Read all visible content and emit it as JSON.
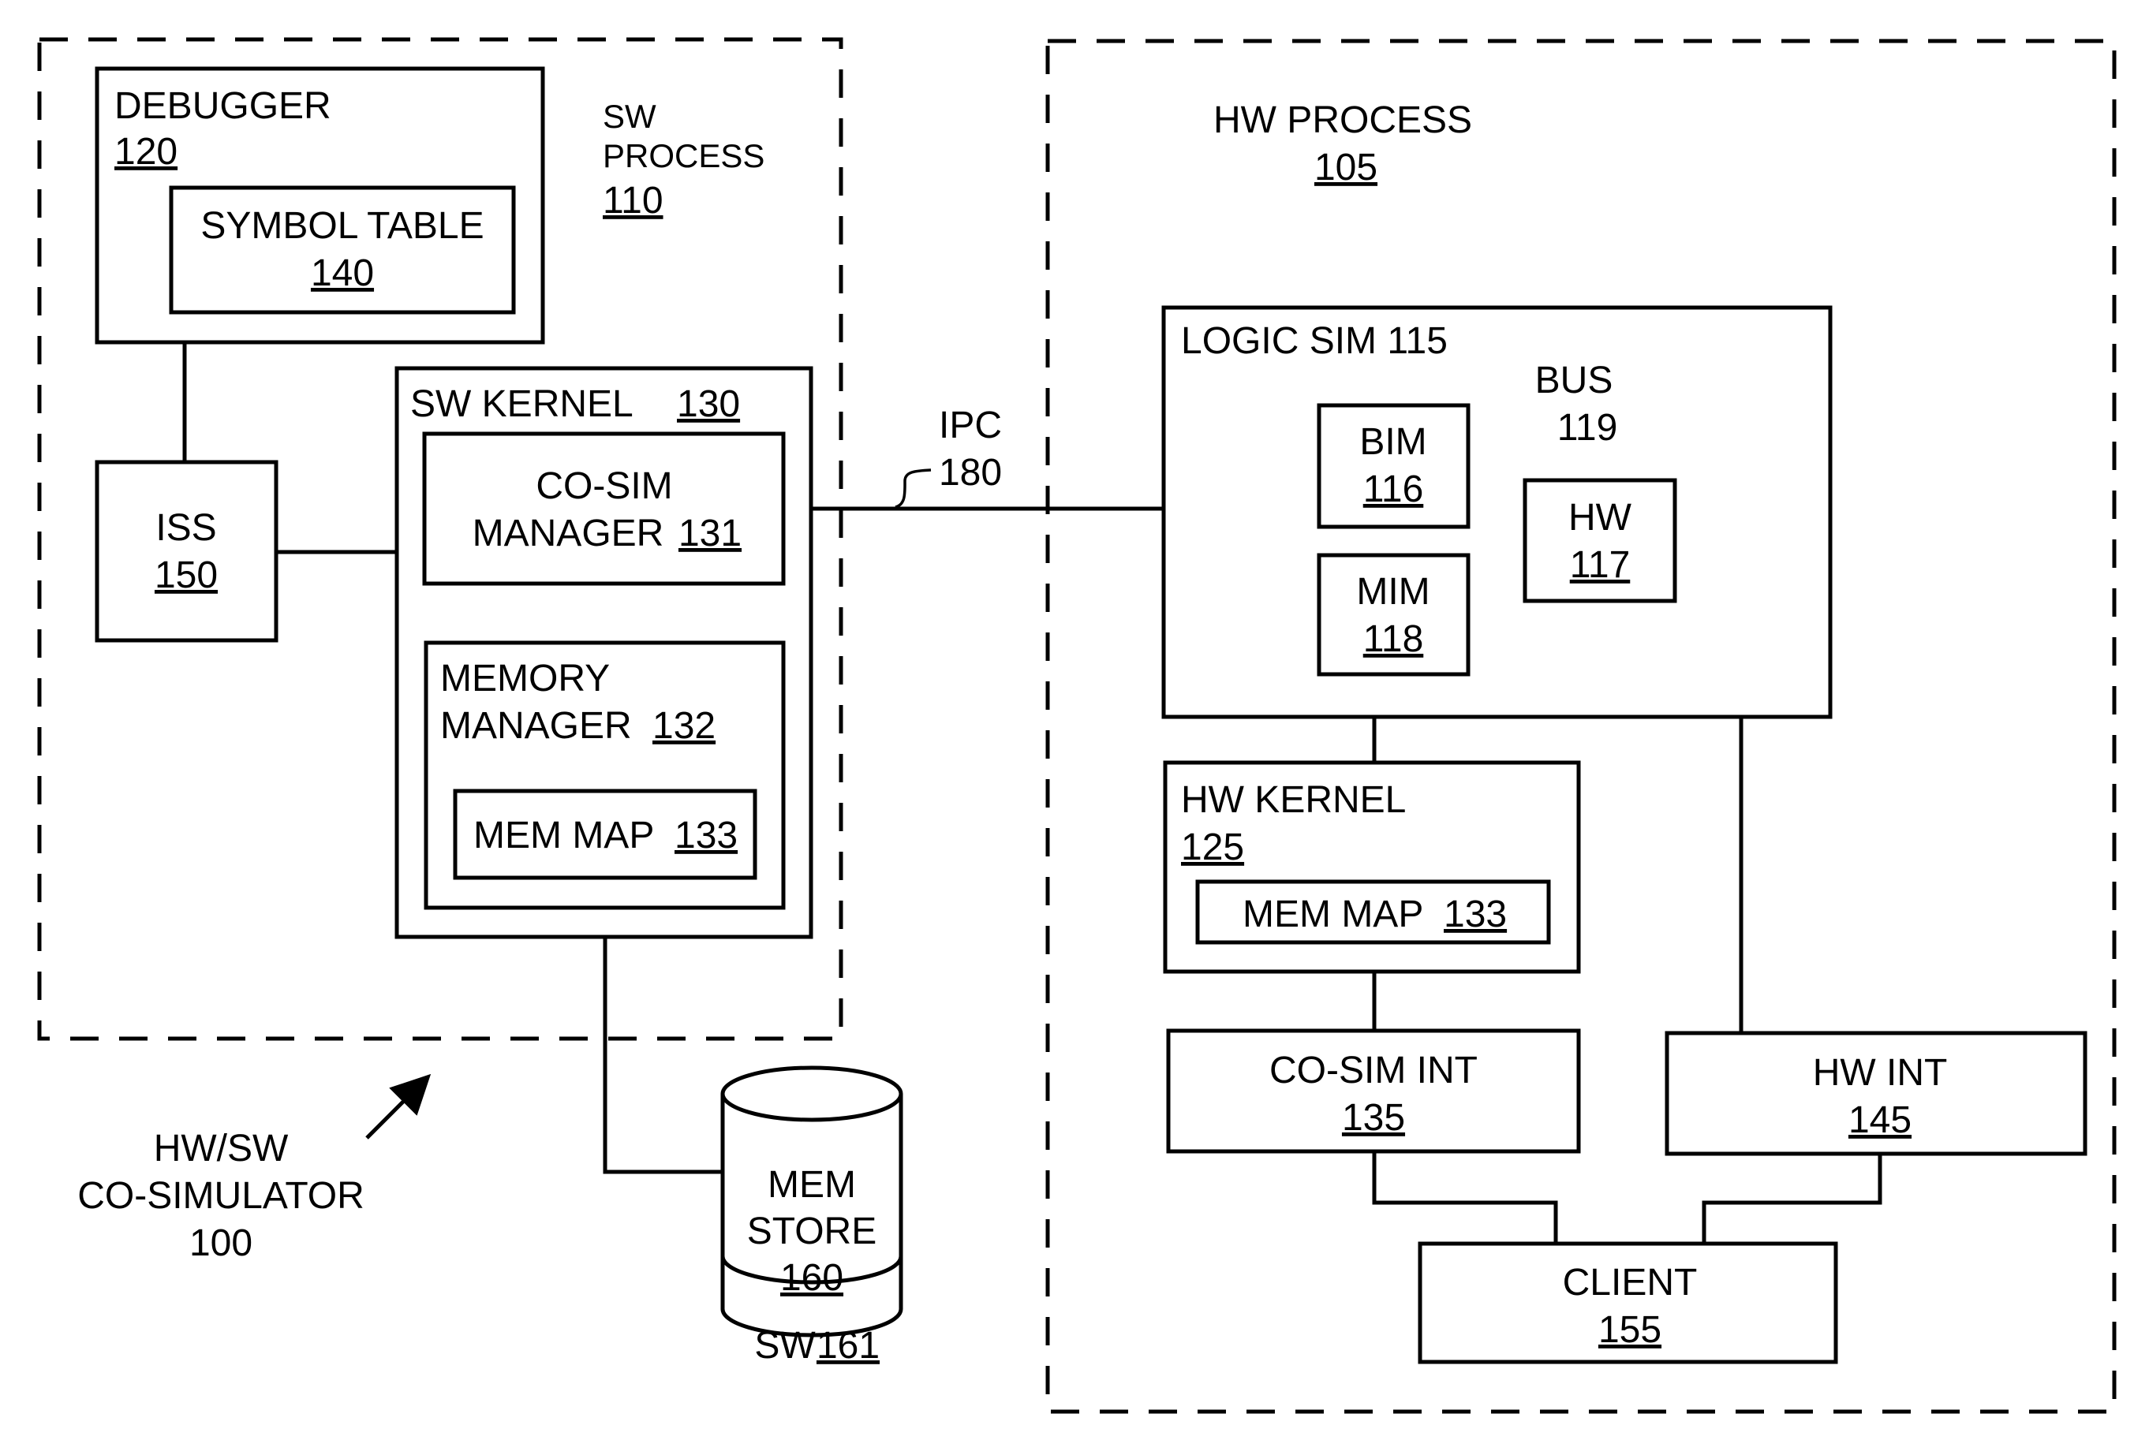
{
  "figure": {
    "sw_process": {
      "label": "SW",
      "label2": "PROCESS",
      "ref": "110"
    },
    "hw_process": {
      "label": "HW PROCESS",
      "ref": "105"
    },
    "debugger": {
      "label": "DEBUGGER",
      "ref": "120"
    },
    "symbol_table": {
      "label": "SYMBOL TABLE",
      "ref": "140"
    },
    "iss": {
      "label": "ISS",
      "ref": "150"
    },
    "sw_kernel": {
      "label": "SW KERNEL",
      "ref": "130"
    },
    "cosim_manager": {
      "label": "CO-SIM",
      "label2": "MANAGER",
      "ref": "131"
    },
    "memory_manager": {
      "label": "MEMORY",
      "label2": "MANAGER",
      "ref": "132"
    },
    "mem_map_sw": {
      "label": "MEM MAP",
      "ref": "133"
    },
    "mem_store": {
      "label": "MEM",
      "label2": "STORE",
      "ref": "160"
    },
    "sw_store": {
      "label": "SW",
      "ref": "161"
    },
    "ipc": {
      "label": "IPC",
      "ref": "180"
    },
    "logic_sim": {
      "label": "LOGIC SIM 115"
    },
    "bus": {
      "label": "BUS",
      "ref": "119"
    },
    "bim": {
      "label": "BIM",
      "ref": "116"
    },
    "mim": {
      "label": "MIM",
      "ref": "118"
    },
    "hw_block": {
      "label": "HW",
      "ref": "117"
    },
    "hw_kernel": {
      "label": "HW KERNEL",
      "ref": "125"
    },
    "mem_map_hw": {
      "label": "MEM MAP",
      "ref": "133"
    },
    "cosim_int": {
      "label": "CO-SIM INT",
      "ref": "135"
    },
    "hw_int": {
      "label": "HW INT",
      "ref": "145"
    },
    "client": {
      "label": "CLIENT",
      "ref": "155"
    },
    "cosimulator": {
      "label": "HW/SW",
      "label2": "CO-SIMULATOR",
      "ref": "100"
    }
  }
}
